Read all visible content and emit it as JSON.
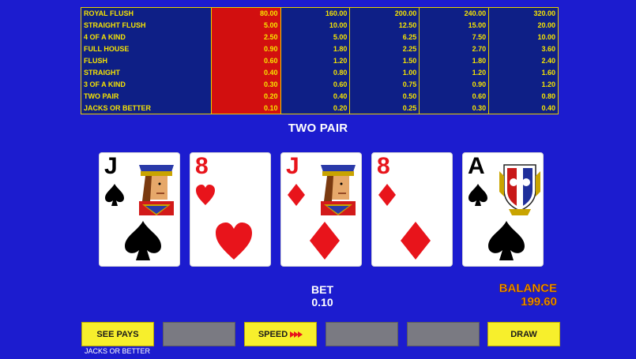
{
  "paytable": {
    "rows": [
      {
        "hand": "ROYAL FLUSH",
        "values": [
          "80.00",
          "160.00",
          "200.00",
          "240.00",
          "320.00"
        ]
      },
      {
        "hand": "STRAIGHT FLUSH",
        "values": [
          "5.00",
          "10.00",
          "12.50",
          "15.00",
          "20.00"
        ]
      },
      {
        "hand": "4 OF A KIND",
        "values": [
          "2.50",
          "5.00",
          "6.25",
          "7.50",
          "10.00"
        ]
      },
      {
        "hand": "FULL HOUSE",
        "values": [
          "0.90",
          "1.80",
          "2.25",
          "2.70",
          "3.60"
        ]
      },
      {
        "hand": "FLUSH",
        "values": [
          "0.60",
          "1.20",
          "1.50",
          "1.80",
          "2.40"
        ]
      },
      {
        "hand": "STRAIGHT",
        "values": [
          "0.40",
          "0.80",
          "1.00",
          "1.20",
          "1.60"
        ]
      },
      {
        "hand": "3 OF A KIND",
        "values": [
          "0.30",
          "0.60",
          "0.75",
          "0.90",
          "1.20"
        ]
      },
      {
        "hand": "TWO PAIR",
        "values": [
          "0.20",
          "0.40",
          "0.50",
          "0.60",
          "0.80"
        ]
      },
      {
        "hand": "JACKS OR BETTER",
        "values": [
          "0.10",
          "0.20",
          "0.25",
          "0.30",
          "0.40"
        ]
      }
    ],
    "highlight_color": "#d20f0f",
    "text_color": "#f6e400"
  },
  "result": "TWO PAIR",
  "cards": [
    {
      "rank": "J",
      "suit": "spade-icon",
      "color": "black"
    },
    {
      "rank": "8",
      "suit": "heart-icon",
      "color": "red"
    },
    {
      "rank": "J",
      "suit": "diamond-icon",
      "color": "red"
    },
    {
      "rank": "8",
      "suit": "diamond-icon",
      "color": "red"
    },
    {
      "rank": "A",
      "suit": "spade-icon",
      "color": "black"
    }
  ],
  "bet": {
    "label": "BET",
    "value": "0.10"
  },
  "balance": {
    "label": "BALANCE",
    "value": "199.60"
  },
  "buttons": {
    "see_pays": "SEE PAYS",
    "speed": "SPEED",
    "draw": "DRAW"
  },
  "game_name": "JACKS OR BETTER",
  "colors": {
    "background": "#1c1ccf",
    "button": "#f7ef2c",
    "balance": "#ff9a00"
  }
}
